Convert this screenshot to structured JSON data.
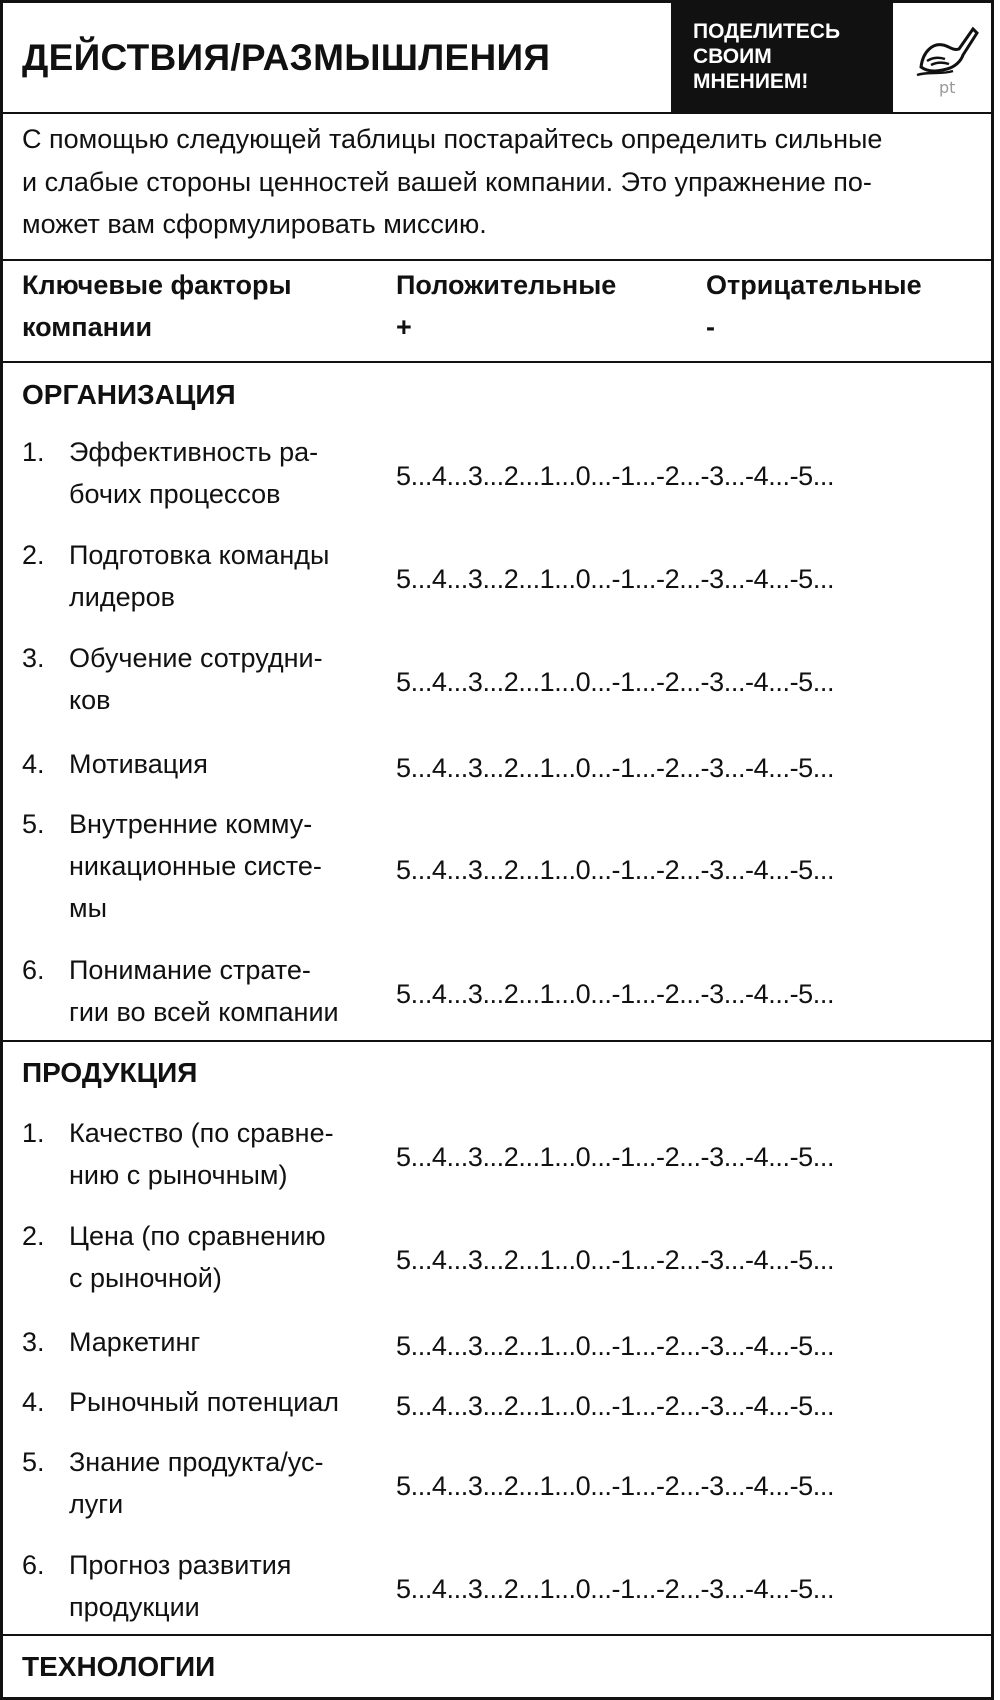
{
  "header": {
    "title": "ДЕЙСТВИЯ/РАЗМЫШЛЕНИЯ",
    "share_lines": [
      "ПОДЕЛИТЕСЬ",
      "СВОИМ",
      "МНЕНИЕМ!"
    ],
    "pen_icon_text": "pt",
    "pen_icon": "pen-writing-icon"
  },
  "intro": {
    "lines": [
      "С помощью следующей таблицы постарайтесь определить сильные",
      "и слабые стороны ценностей вашей компании. Это упражнение по-",
      "может вам сформулировать миссию."
    ]
  },
  "columns": {
    "factors": [
      "Ключевые факторы",
      "компании"
    ],
    "positive": [
      "Положительные",
      "+"
    ],
    "negative": [
      "Отрицательные",
      "-"
    ]
  },
  "scale_text": "5...4...3...2...1...0...-1...-2...-3...-4...-5...",
  "sections": [
    {
      "title": "ОРГАНИЗАЦИЯ",
      "items": [
        {
          "num": "1.",
          "lines": [
            "Эффективность ра-",
            "бочих процессов"
          ]
        },
        {
          "num": "2.",
          "lines": [
            "Подготовка команды",
            "лидеров"
          ]
        },
        {
          "num": "3.",
          "lines": [
            "Обучение сотрудни-",
            "ков"
          ]
        },
        {
          "num": "4.",
          "lines": [
            "Мотивация"
          ]
        },
        {
          "num": "5.",
          "lines": [
            "Внутренние комму-",
            "никационные систе-",
            "мы"
          ]
        },
        {
          "num": "6.",
          "lines": [
            "Понимание страте-",
            "гии во всей компании"
          ]
        }
      ]
    },
    {
      "title": "ПРОДУКЦИЯ",
      "items": [
        {
          "num": "1.",
          "lines": [
            "Качество (по сравне-",
            "нию с рыночным)"
          ]
        },
        {
          "num": "2.",
          "lines": [
            "Цена (по сравнению",
            "с рыночной)"
          ]
        },
        {
          "num": "3.",
          "lines": [
            "Маркетинг"
          ]
        },
        {
          "num": "4.",
          "lines": [
            "Рыночный потенциал"
          ]
        },
        {
          "num": "5.",
          "lines": [
            "Знание продукта/ус-",
            "луги"
          ]
        },
        {
          "num": "6.",
          "lines": [
            "Прогноз развития",
            "продукции"
          ]
        }
      ]
    },
    {
      "title": "ТЕХНОЛОГИИ",
      "items": []
    }
  ]
}
